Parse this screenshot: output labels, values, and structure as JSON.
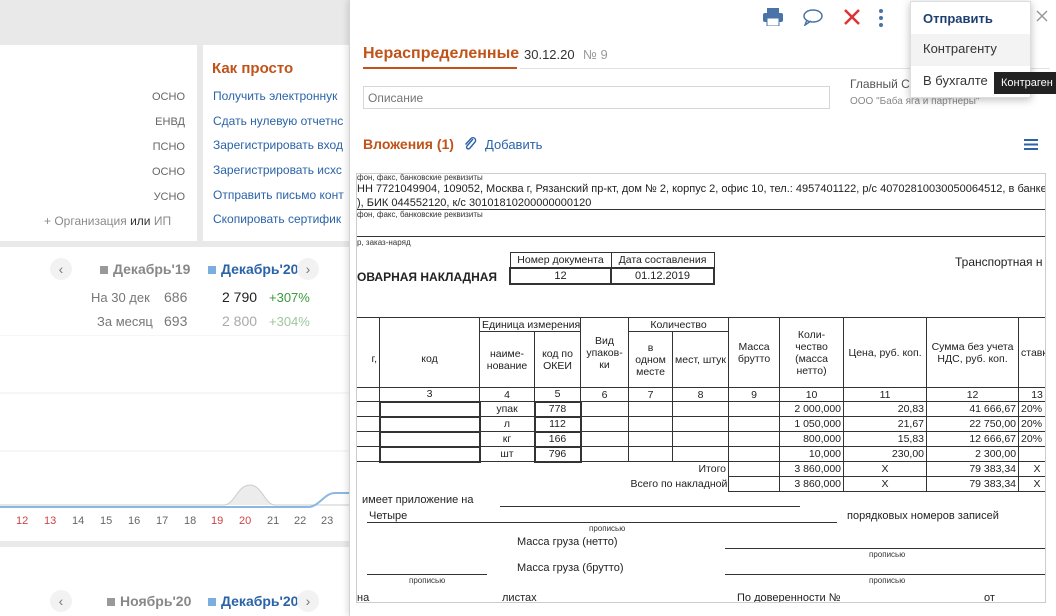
{
  "left": {
    "taxes": [
      "ОСНО",
      "ЕНВД",
      "ПСНО",
      "ОСНО",
      "УСНО"
    ],
    "add_prefix": "+ Организация",
    "add_or": "или",
    "add_ip": "ИП",
    "simple": {
      "title": "Как просто",
      "links": [
        "Получить электроннук",
        "Сдать нулевую отчетнс",
        "Зарегистрировать вход",
        "Зарегистрировать исхс",
        "Отправить письмо конт",
        "Скопировать сертифик"
      ]
    },
    "stats1": {
      "prev": "Декабрь'19",
      "cur": "Декабрь'20",
      "row1_label": "На 30 дек",
      "row1_prev": "686",
      "row1_cur": "2 790",
      "row1_delta": "+307%",
      "row2_label": "За месяц",
      "row2_prev": "693",
      "row2_cur": "2 800",
      "row2_delta": "+304%"
    },
    "days": [
      "12",
      "13",
      "14",
      "15",
      "16",
      "17",
      "18",
      "19",
      "20",
      "21",
      "22",
      "23"
    ],
    "stats2": {
      "prev": "Ноябрь'20",
      "cur": "Декабрь'20"
    }
  },
  "doc": {
    "title": "Нераспределенные",
    "date": "30.12.20",
    "number": "№ 9",
    "description_placeholder": "Описание",
    "chief_label": "Главный С",
    "org": "ООО \"Баба яга и партнеры\"",
    "attachments": "Вложения (1)",
    "add": "Добавить",
    "menu": {
      "send": "Отправить",
      "counterparty": "Контрагенту",
      "accounting": "В бухгалте"
    },
    "tooltip": "Контраген",
    "sheet": {
      "req1": "фон, факс, банковские реквизиты",
      "line1": "НН 7721049904, 109052, Москва г, Рязанский пр-кт, дом № 2, корпус 2, офис 10, тел.: 4957401122, р/с 40702810030050064512, в банке",
      "line2": "), БИК 044552120, к/с 30101810200000000120",
      "req2": "фон, факс, банковские реквизиты",
      "req3": "р, заказ-наряд",
      "doc_no_label": "Номер документа",
      "doc_date_label": "Дата составления",
      "doc_no": "12",
      "doc_date": "01.12.2019",
      "form_title": "ОВАРНАЯ НАКЛАДНАЯ",
      "transport": "Транспортная н",
      "h": {
        "unit": "Единица измерения",
        "qty": "Количество",
        "code": "код",
        "name": "наиме-нование",
        "okei": "код по ОКЕИ",
        "pack": "Вид упаков-ки",
        "one": "в одном месте",
        "places": "мест, штук",
        "gross": "Масса брутто",
        "net": "Коли-чество (масса нетто)",
        "price": "Цена, руб. коп.",
        "sum": "Сумма без учета НДС, руб. коп.",
        "rate": "ставка",
        "col1": "г,"
      },
      "nums": [
        "3",
        "4",
        "5",
        "6",
        "7",
        "8",
        "9",
        "10",
        "11",
        "12",
        "13"
      ],
      "rows": [
        {
          "unit": "упак",
          "okei": "778",
          "qty": "2 000,000",
          "price": "20,83",
          "sum": "41 666,67",
          "rate": "20%"
        },
        {
          "unit": "л",
          "okei": "112",
          "qty": "1 050,000",
          "price": "21,67",
          "sum": "22 750,00",
          "rate": "20%"
        },
        {
          "unit": "кг",
          "okei": "166",
          "qty": "800,000",
          "price": "15,83",
          "sum": "12 666,67",
          "rate": "20%"
        },
        {
          "unit": "шт",
          "okei": "796",
          "qty": "10,000",
          "price": "230,00",
          "sum": "2 300,00",
          "rate": ""
        }
      ],
      "total_label": "Итого",
      "total_qty": "3 860,000",
      "total_x": "X",
      "total_sum": "79 383,34",
      "grand_label": "Всего по накладной",
      "grand_qty": "3 860,000",
      "grand_sum": "79 383,34",
      "appendix": "имеет приложение на",
      "four": "Четыре",
      "records": "порядковых номеров записей",
      "propisyu": "прописью",
      "net_mass": "Масса груза (нетто)",
      "gross_mass": "Масса груза (брутто)",
      "na": "на",
      "sheets": "листах",
      "proxy": "По доверенности №",
      "from": "от"
    }
  }
}
